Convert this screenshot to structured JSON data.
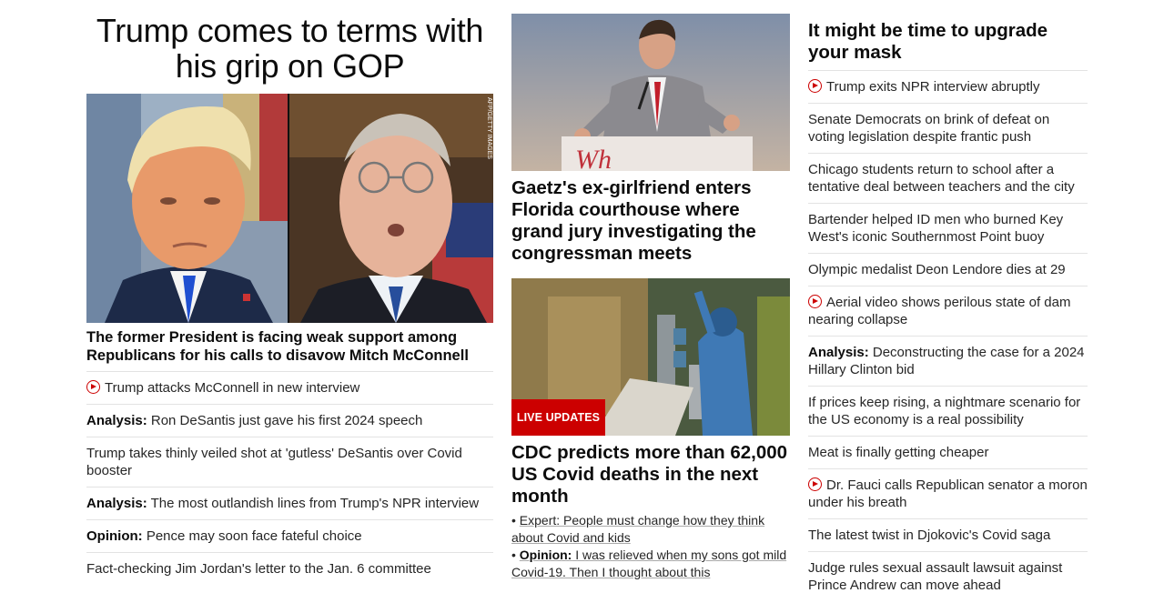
{
  "col1": {
    "title": "Trump comes to terms with his grip on GOP",
    "image_credit": "AFP/GETTY IMAGES",
    "subheadline": "The former President is facing weak support among Republicans for his calls to disavow Mitch McConnell",
    "items": [
      {
        "video": true,
        "prefix": "",
        "text": "Trump attacks McConnell in new interview"
      },
      {
        "video": false,
        "prefix": "Analysis:",
        "text": " Ron DeSantis just gave his first 2024 speech"
      },
      {
        "video": false,
        "prefix": "",
        "text": "Trump takes thinly veiled shot at 'gutless' DeSantis over Covid booster"
      },
      {
        "video": false,
        "prefix": "Analysis:",
        "text": " The most outlandish lines from Trump's NPR interview"
      },
      {
        "video": false,
        "prefix": "Opinion:",
        "text": " Pence may soon face fateful choice"
      },
      {
        "video": false,
        "prefix": "",
        "text": "Fact-checking Jim Jordan's letter to the Jan. 6 committee"
      }
    ]
  },
  "col2": {
    "story1_headline": "Gaetz's ex-girlfriend enters Florida courthouse where grand jury investigating the congressman meets",
    "story2_badge": "LIVE UPDATES",
    "story2_headline": "CDC predicts more than 62,000 US Covid deaths in the next month",
    "story2_bullets": [
      {
        "prefix": "",
        "text": "Expert: People must change how they think about Covid and kids"
      },
      {
        "prefix": "Opinion:",
        "text": " I was relieved when my sons got mild Covid-19. Then I thought about this"
      }
    ]
  },
  "col3": {
    "title": "It might be time to upgrade your mask",
    "items": [
      {
        "video": true,
        "prefix": "",
        "text": "Trump exits NPR interview abruptly"
      },
      {
        "video": false,
        "prefix": "",
        "text": "Senate Democrats on brink of defeat on voting legislation despite frantic push"
      },
      {
        "video": false,
        "prefix": "",
        "text": "Chicago students return to school after a tentative deal between teachers and the city"
      },
      {
        "video": false,
        "prefix": "",
        "text": "Bartender helped ID men who burned Key West's iconic Southernmost Point buoy"
      },
      {
        "video": false,
        "prefix": "",
        "text": "Olympic medalist Deon Lendore dies at 29"
      },
      {
        "video": true,
        "prefix": "",
        "text": "Aerial video shows perilous state of dam nearing collapse"
      },
      {
        "video": false,
        "prefix": "Analysis:",
        "text": " Deconstructing the case for a 2024 Hillary Clinton bid"
      },
      {
        "video": false,
        "prefix": "",
        "text": "If prices keep rising, a nightmare scenario for the US economy is a real possibility"
      },
      {
        "video": false,
        "prefix": "",
        "text": "Meat is finally getting cheaper"
      },
      {
        "video": true,
        "prefix": "",
        "text": "Dr. Fauci calls Republican senator a moron under his breath"
      },
      {
        "video": false,
        "prefix": "",
        "text": "The latest twist in Djokovic's Covid saga"
      },
      {
        "video": false,
        "prefix": "",
        "text": "Judge rules sexual assault lawsuit against Prince Andrew can move ahead"
      }
    ]
  },
  "colors": {
    "accent": "#cc0000",
    "divider": "#e3e3e3",
    "text": "#0c0c0c"
  },
  "icons": {
    "video": "play-circle-icon"
  }
}
